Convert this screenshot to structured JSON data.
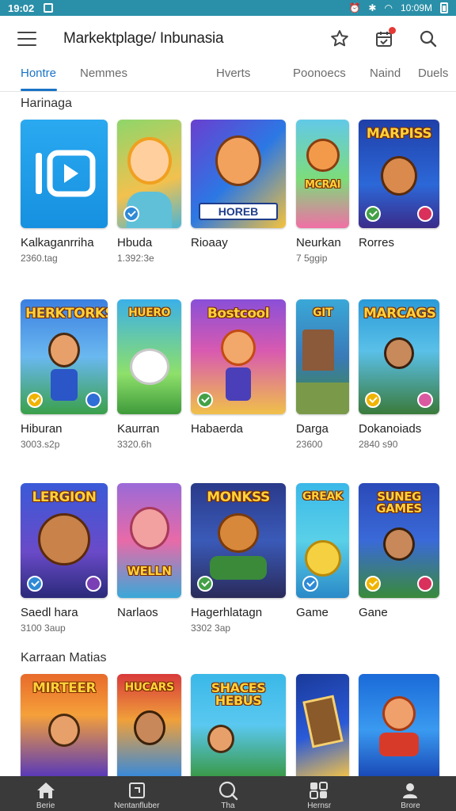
{
  "status": {
    "time": "19:02",
    "right_text": "10:09M"
  },
  "appbar": {
    "title": "Markektplage/ Inbunasia",
    "icons": [
      "menu-icon",
      "star-icon",
      "calendar-icon",
      "search-icon"
    ]
  },
  "tabs": [
    {
      "label": "Hontre",
      "active": true
    },
    {
      "label": "Nemmes"
    },
    {
      "label": "Hverts"
    },
    {
      "label": "Poonoecs"
    },
    {
      "label": "Naind"
    },
    {
      "label": "Duels"
    }
  ],
  "sections": [
    {
      "title": "Harinaga"
    },
    {
      "title": "Karraan Matias"
    }
  ],
  "rows": [
    {
      "apps": [
        {
          "name": "Kalkaganrriha",
          "meta": "2360.tag"
        },
        {
          "name": "Hbuda",
          "meta": "1.392:3e"
        },
        {
          "name": "Rioaay",
          "meta": "",
          "art_text": "HOREB"
        },
        {
          "name": "Neurkan",
          "meta": "7 5ggip",
          "art_text": "MCRAI"
        },
        {
          "name": "Rorres",
          "meta": "",
          "art_text": "MARPISS"
        }
      ]
    },
    {
      "apps": [
        {
          "name": "Hiburan",
          "meta": "3003.s2p",
          "art_text": "HERKTORKS"
        },
        {
          "name": "Kaurran",
          "meta": "3320.6h",
          "art_text": "HUERO"
        },
        {
          "name": "Habaerda",
          "meta": "",
          "art_text": "Bostcool"
        },
        {
          "name": "Darga",
          "meta": "23600",
          "art_text": "GIT"
        },
        {
          "name": "Dokanoiads",
          "meta": "2840 s90",
          "art_text": "MARCAGS"
        }
      ]
    },
    {
      "apps": [
        {
          "name": "Saedl hara",
          "meta": "3100 3aup",
          "art_text": "LERGION"
        },
        {
          "name": "Narlaos",
          "meta": "",
          "art_text": "WELLN"
        },
        {
          "name": "Hagerhlatagn",
          "meta": "3302 3ap",
          "art_text": "MONKSS"
        },
        {
          "name": "Game",
          "meta": "",
          "art_text": "GREAK"
        },
        {
          "name": "Gane",
          "meta": "",
          "art_text": "SUNEG GAMES"
        }
      ]
    },
    {
      "apps": [
        {
          "name": "",
          "meta": "",
          "art_text": "MIRTEER"
        },
        {
          "name": "",
          "meta": "",
          "art_text": "HUCARS"
        },
        {
          "name": "",
          "meta": "",
          "art_text": "SHACES HEBUS"
        },
        {
          "name": "",
          "meta": ""
        },
        {
          "name": "",
          "meta": ""
        }
      ]
    }
  ],
  "bottomnav": [
    {
      "label": "Berie",
      "icon": "home-icon"
    },
    {
      "label": "Nentanfluber",
      "icon": "square-icon"
    },
    {
      "label": "Tha",
      "icon": "search-icon"
    },
    {
      "label": "Hernsr",
      "icon": "apps-icon"
    },
    {
      "label": "Brore",
      "icon": "profile-icon"
    }
  ],
  "colors": {
    "statusbar": "#2a8fa8",
    "accent": "#1a73c7",
    "bottomnav": "#3a3a3a"
  }
}
